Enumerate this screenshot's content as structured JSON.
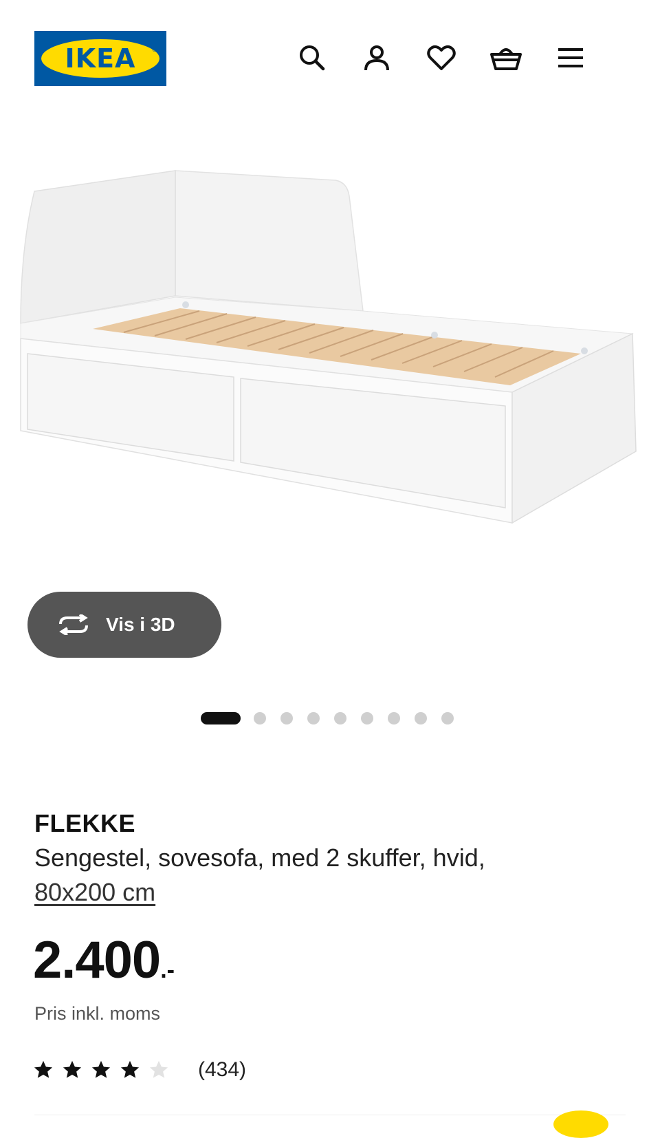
{
  "header": {
    "logo_text": "IKEA",
    "logo_mark": "®",
    "icons": [
      "search-icon",
      "user-icon",
      "heart-icon",
      "basket-icon",
      "menu-icon"
    ]
  },
  "gallery": {
    "image_alt": "FLEKKE daybed frame, white, with 2 drawers",
    "view_3d_label": "Vis i 3D",
    "dot_count": 9,
    "active_index": 0
  },
  "product": {
    "name": "FLEKKE",
    "description": "Sengestel, sovesofa, med 2 skuffer, hvid,",
    "size": "80x200 cm",
    "price_main": "2.400",
    "price_suffix": ".-",
    "price_note": "Pris inkl. moms",
    "rating": 4,
    "rating_max": 5,
    "review_count": "(434)"
  },
  "colors": {
    "brand_blue": "#0058a3",
    "brand_yellow": "#ffdb00",
    "button_dark": "#555555"
  }
}
